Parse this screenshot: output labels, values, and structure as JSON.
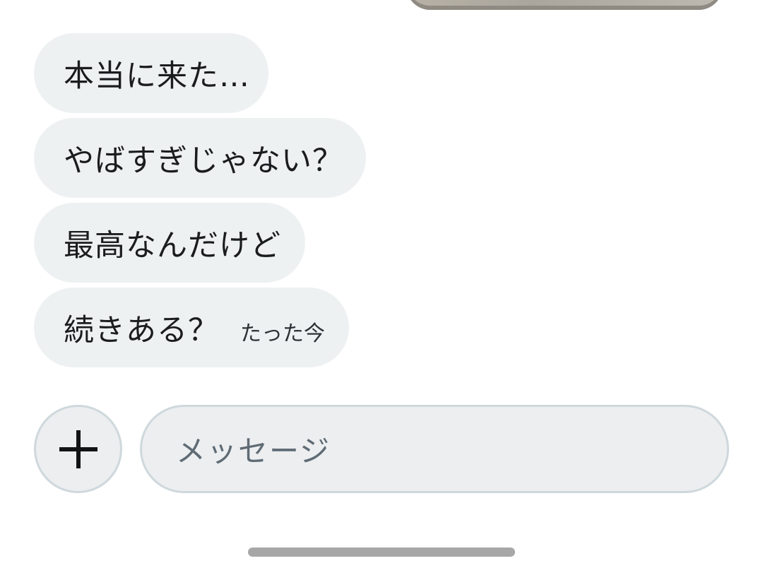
{
  "messages": [
    {
      "text": "本当に来た…"
    },
    {
      "text": "やばすぎじゃない？"
    },
    {
      "text": "最高なんだけど"
    },
    {
      "text": "続きある？",
      "time": "たった今"
    }
  ],
  "composer": {
    "add_icon": "plus-icon",
    "placeholder": "メッセージ"
  },
  "colors": {
    "bubble_bg": "#eef1f2",
    "input_bg": "#eceef0",
    "border": "#cfd8dc",
    "text": "#1a1c1e",
    "placeholder": "#5f6b74"
  }
}
